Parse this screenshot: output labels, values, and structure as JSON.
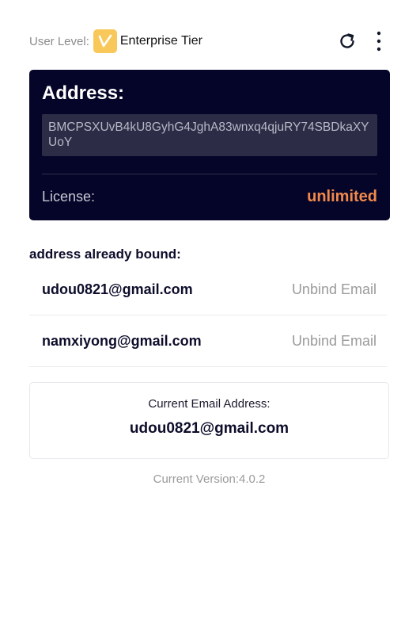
{
  "header": {
    "user_level_label": "User Level:",
    "tier_name": "Enterprise Tier",
    "badge_icon": "check-badge-icon",
    "refresh_icon": "refresh-icon",
    "menu_icon": "more-vertical-icon"
  },
  "address_card": {
    "title": "Address:",
    "address": "BMCPSXUvB4kU8GyhG4JghA83wnxq4qjuRY74SBDkaXYUoY",
    "license_label": "License:",
    "license_value": "unlimited"
  },
  "bound": {
    "title": "address already bound:",
    "items": [
      {
        "email": "udou0821@gmail.com",
        "action": "Unbind Email"
      },
      {
        "email": "namxiyong@gmail.com",
        "action": "Unbind Email"
      }
    ]
  },
  "current": {
    "label": "Current Email Address:",
    "email": "udou0821@gmail.com"
  },
  "footer": {
    "version": "Current Version:4.0.2"
  },
  "colors": {
    "card_bg": "#050529",
    "accent_orange": "#f2894a",
    "badge_yellow": "#f8c85a"
  }
}
